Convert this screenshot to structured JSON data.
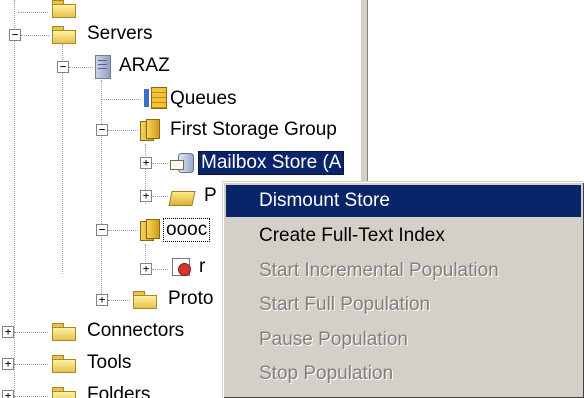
{
  "tree": {
    "servers": "Servers",
    "server_name": "ARAZ",
    "queues": "Queues",
    "first_storage_group": "First Storage Group",
    "mailbox_store": "Mailbox Store (A",
    "public_store": "P",
    "second_group": "oooc",
    "second_child": "r",
    "protocols": "Proto",
    "connectors": "Connectors",
    "tools": "Tools",
    "folders": "Folders"
  },
  "context_menu": {
    "items": [
      {
        "label": "Dismount Store",
        "state": "highlighted"
      },
      {
        "label": "Create Full-Text Index",
        "state": "enabled"
      },
      {
        "label": "Start Incremental Population",
        "state": "disabled"
      },
      {
        "label": "Start Full Population",
        "state": "disabled"
      },
      {
        "label": "Pause Population",
        "state": "disabled"
      },
      {
        "label": "Stop Population",
        "state": "disabled"
      }
    ]
  },
  "colors": {
    "selection": "#0a246a",
    "menu_bg": "#d4d0c8",
    "disabled_text": "#808080"
  },
  "icons": [
    "folder-icon",
    "server-icon",
    "queues-icon",
    "storage-group-icon",
    "mailbox-store-icon",
    "public-store-icon",
    "mailbox-icon"
  ]
}
